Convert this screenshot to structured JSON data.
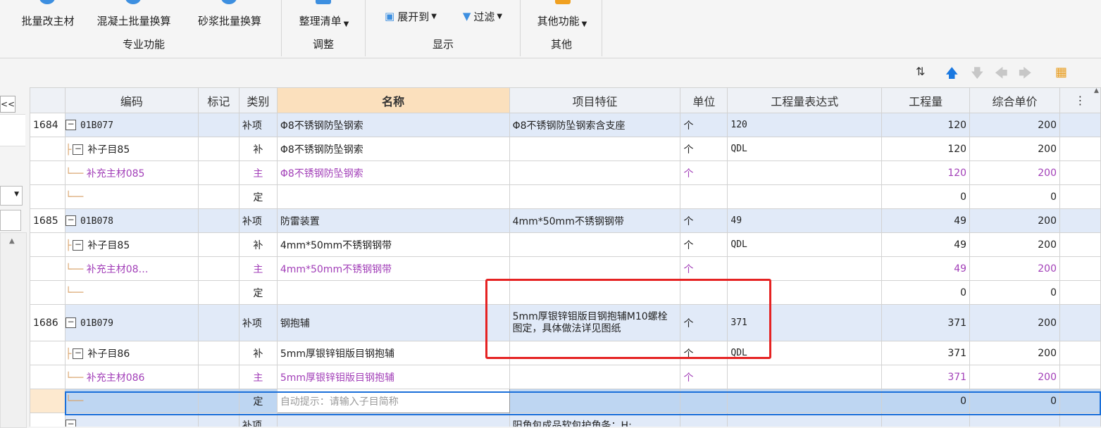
{
  "ribbon": {
    "buttons": [
      {
        "label": "批量改主材",
        "icon": "batch-material-icon"
      },
      {
        "label": "混凝土批量换算",
        "icon": "concrete-convert-icon"
      },
      {
        "label": "砂浆批量换算",
        "icon": "mortar-convert-icon"
      },
      {
        "label": "整理清单",
        "icon": "organize-list-icon"
      },
      {
        "label": "展开到",
        "icon": "expand-icon"
      },
      {
        "label": "过滤",
        "icon": "filter-icon"
      },
      {
        "label": "其他功能",
        "icon": "other-functions-icon"
      }
    ],
    "groups": [
      "专业功能",
      "调整",
      "显示",
      "其他"
    ]
  },
  "toolbar": {
    "icons": [
      "sort-icon",
      "move-up-icon",
      "move-down-icon",
      "move-left-icon",
      "move-right-icon",
      "settings-icon"
    ]
  },
  "leftpanel": {
    "collapse": "<<"
  },
  "columns": [
    "编码",
    "标记",
    "类别",
    "名称",
    "项目特征",
    "单位",
    "工程量表达式",
    "工程量",
    "综合单价"
  ],
  "rows": [
    {
      "num": "1684",
      "code": "01B077",
      "mark": "",
      "cat": "补项",
      "name": "Φ8不锈钢防坠钢索",
      "feat": "Φ8不锈钢防坠钢索含支座",
      "unit": "个",
      "expr": "120",
      "qty": "120",
      "price": "200"
    },
    {
      "num": "",
      "code": "补子目85",
      "mark": "",
      "cat": "补",
      "name": "Φ8不锈钢防坠钢索",
      "feat": "",
      "unit": "个",
      "expr": "QDL",
      "qty": "120",
      "price": "200"
    },
    {
      "num": "",
      "code": "补充主材085",
      "mark": "",
      "cat": "主",
      "name": "Φ8不锈钢防坠钢索",
      "feat": "",
      "unit": "个",
      "expr": "",
      "qty": "120",
      "price": "200"
    },
    {
      "num": "",
      "code": "",
      "mark": "",
      "cat": "定",
      "name": "",
      "feat": "",
      "unit": "",
      "expr": "",
      "qty": "0",
      "price": "0"
    },
    {
      "num": "1685",
      "code": "01B078",
      "mark": "",
      "cat": "补项",
      "name": "防雷装置",
      "feat": "4mm*50mm不锈钢钢带",
      "unit": "个",
      "expr": "49",
      "qty": "49",
      "price": "200"
    },
    {
      "num": "",
      "code": "补子目85",
      "mark": "",
      "cat": "补",
      "name": "4mm*50mm不锈钢钢带",
      "feat": "",
      "unit": "个",
      "expr": "QDL",
      "qty": "49",
      "price": "200"
    },
    {
      "num": "",
      "code": "补充主材08…",
      "mark": "",
      "cat": "主",
      "name": "4mm*50mm不锈钢钢带",
      "feat": "",
      "unit": "个",
      "expr": "",
      "qty": "49",
      "price": "200"
    },
    {
      "num": "",
      "code": "",
      "mark": "",
      "cat": "定",
      "name": "",
      "feat": "",
      "unit": "",
      "expr": "",
      "qty": "0",
      "price": "0"
    },
    {
      "num": "1686",
      "code": "01B079",
      "mark": "",
      "cat": "补项",
      "name": "钢抱辅",
      "feat": "5mm厚银锌钼版目钢抱辅M10螺栓图定，具体做法详见图纸",
      "unit": "个",
      "expr": "371",
      "qty": "371",
      "price": "200"
    },
    {
      "num": "",
      "code": "补子目86",
      "mark": "",
      "cat": "补",
      "name": "5mm厚银锌钼版目钢抱辅",
      "feat": "",
      "unit": "个",
      "expr": "QDL",
      "qty": "371",
      "price": "200"
    },
    {
      "num": "",
      "code": "补充主材086",
      "mark": "",
      "cat": "主",
      "name": "5mm厚银锌钼版目钢抱辅",
      "feat": "",
      "unit": "个",
      "expr": "",
      "qty": "371",
      "price": "200"
    },
    {
      "num": "",
      "code": "",
      "mark": "",
      "cat": "定",
      "name": "自动提示：请输入子目简称",
      "feat": "",
      "unit": "",
      "expr": "",
      "qty": "0",
      "price": "0"
    },
    {
      "num": "",
      "code": "",
      "mark": "",
      "cat": "补项",
      "name": "",
      "feat": "阳角包成品软包护角条：H:",
      "unit": "",
      "expr": "",
      "qty": "",
      "price": ""
    }
  ]
}
